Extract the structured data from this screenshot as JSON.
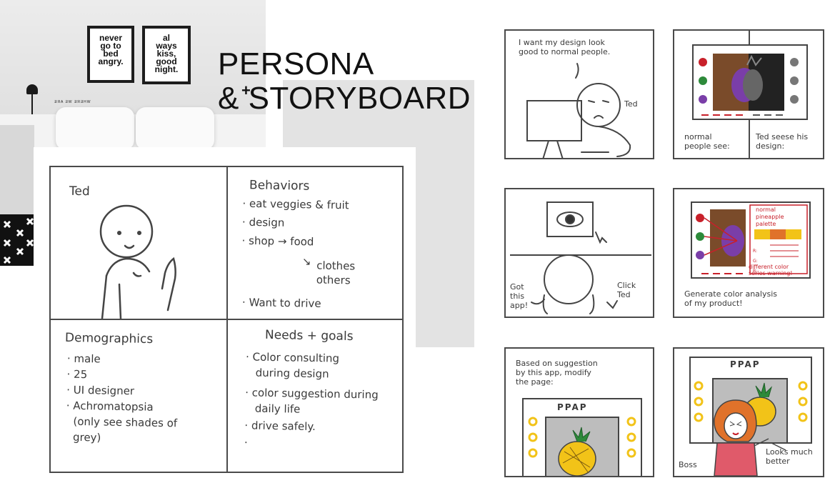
{
  "header": {
    "title_line1": "PERSONA",
    "title_line2": "& STORYBOARD"
  },
  "photo": {
    "poster_left": "never\ngo to\nbed\nangry.",
    "poster_right": "al\nways\nkiss,\ngood\nnight.",
    "shelf_text": "ƎЯA ƎW ƎЯƎHW"
  },
  "persona": {
    "name": "Ted",
    "behaviors": {
      "title": "Behaviors",
      "items": [
        "eat veggies & fruit",
        "design",
        "shop",
        "Want to drive"
      ],
      "shop_targets": [
        "food",
        "clothes",
        "others"
      ]
    },
    "demographics": {
      "title": "Demographics",
      "items": [
        "male",
        "25",
        "UI designer",
        "Achromatopsia",
        "(only see shades of",
        "grey)"
      ]
    },
    "needs": {
      "title": "Needs + goals",
      "items": [
        "Color consulting",
        "during design",
        "color suggestion during",
        "daily life",
        "drive safely."
      ]
    }
  },
  "storyboard": {
    "p1_caption": "I want my design look\ngood to normal people.",
    "p1_name": "Ted",
    "p2_left": "normal\npeople see:",
    "p2_right": "Ted seese his\ndesign:",
    "p3_left": "Got\nthis\napp!",
    "p3_right": "Click\nTed",
    "p4_label_top": "normal\npineapple\npalette",
    "p4_rows": [
      "R:",
      "G:",
      "B:"
    ],
    "p4_label_bottom": "different color\nseries warning!",
    "p4_caption": "Generate color analysis\nof my product!",
    "p5_caption": "Based on suggestion\nby this app, modify\nthe page:",
    "p5_screen_title": "PPAP",
    "p6_screen_title": "PPAP",
    "p6_left": "Boss",
    "p6_right": "Looks much\nbetter",
    "colors": {
      "pineapple_yellow": "#f2c318",
      "pineapple_purple": "#7a3ea8",
      "leaf_green": "#2d8a3a",
      "brown": "#7a4b2a",
      "accent_red": "#c8202a",
      "hair_orange": "#e0722a"
    }
  }
}
